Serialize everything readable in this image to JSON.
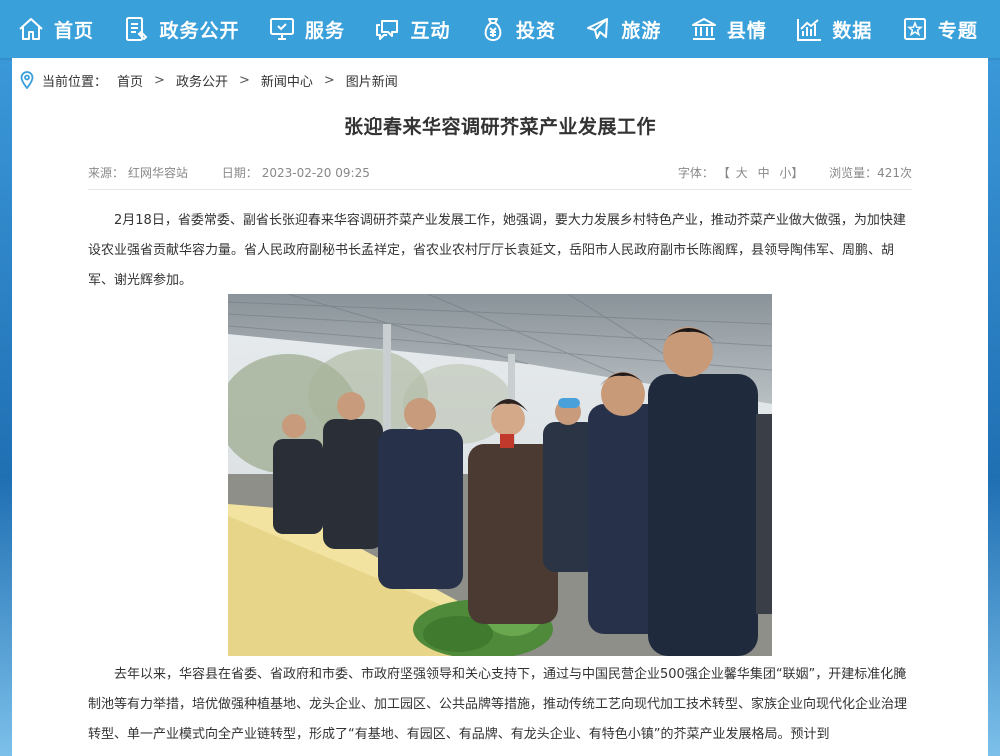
{
  "nav": {
    "items": [
      {
        "label": "首页",
        "icon": "home-icon"
      },
      {
        "label": "政务公开",
        "icon": "document-icon"
      },
      {
        "label": "服务",
        "icon": "monitor-icon"
      },
      {
        "label": "互动",
        "icon": "chat-icon"
      },
      {
        "label": "投资",
        "icon": "money-bag-icon"
      },
      {
        "label": "旅游",
        "icon": "airplane-icon"
      },
      {
        "label": "县情",
        "icon": "building-icon"
      },
      {
        "label": "数据",
        "icon": "chart-icon"
      },
      {
        "label": "专题",
        "icon": "star-icon"
      }
    ]
  },
  "breadcrumb": {
    "label": "当前位置：",
    "items": [
      "首页",
      "政务公开",
      "新闻中心",
      "图片新闻"
    ],
    "separator": ">"
  },
  "article": {
    "title": "张迎春来华容调研芥菜产业发展工作",
    "source": "来源：",
    "source_value": "红网华容站",
    "date_label": "日期：",
    "date_value": "2023-02-20 09:25",
    "font_label": "字体：",
    "font_open": "【",
    "font_large": "大",
    "font_medium": "中",
    "font_small": "小",
    "font_close": "】",
    "views": "浏览量：421次",
    "para1": "2月18日，省委常委、副省长张迎春来华容调研芥菜产业发展工作，她强调，要大力发展乡村特色产业，推动芥菜产业做大做强，为加快建设农业强省贡献华容力量。省人民政府副秘书长孟祥定，省农业农村厅厅长袁延文，岳阳市人民政府副市长陈阁辉，县领导陶伟军、周鹏、胡军、谢光辉参加。",
    "para2": "去年以来，华容县在省委、省政府和市委、市政府坚强领导和关心支持下，通过与中国民营企业500强企业馨华集团“联姻”，开建标准化腌制池等有力举措，培优做强种植基地、龙头企业、加工园区、公共品牌等措施，推动传统工艺向现代加工技术转型、家族企业向现代化企业治理转型、单一产业模式向全产业链转型，形成了“有基地、有园区、有品牌、有龙头企业、有特色小镇”的芥菜产业发展格局。预计到"
  },
  "colors": {
    "nav_bg": "#3aa0da",
    "accent": "#3aa0da"
  }
}
